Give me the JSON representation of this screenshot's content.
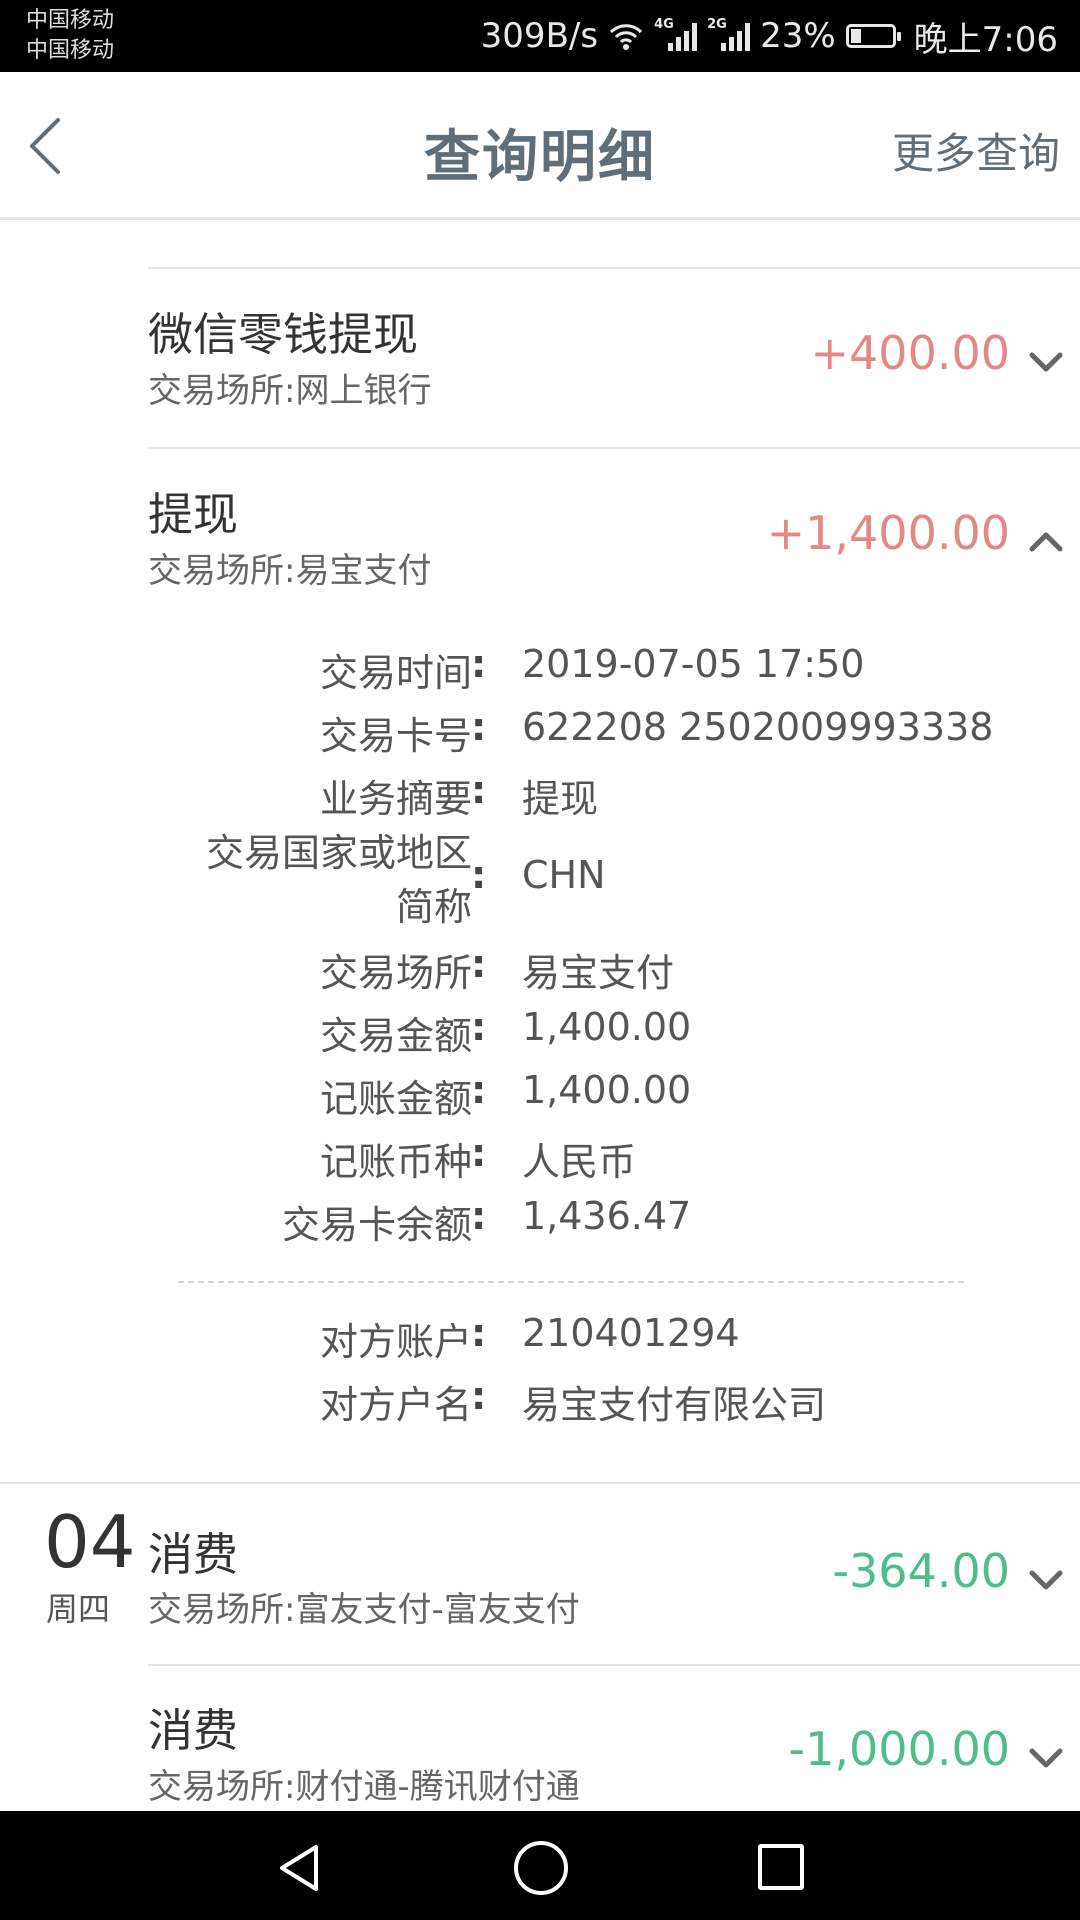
{
  "status_bar": {
    "carrier1": "中国移动",
    "carrier2": "中国移动",
    "net_speed": "309B/s",
    "signal1_tag": "4G",
    "signal2_tag": "2G",
    "battery": "23%",
    "time": "晚上7:06"
  },
  "header": {
    "title": "查询明细",
    "more": "更多查询"
  },
  "transactions": [
    {
      "title": "微信零钱提现",
      "venue": "交易场所:网上银行",
      "amount": "+400.00",
      "type": "income",
      "expanded": false
    },
    {
      "title": "提现",
      "venue": "交易场所:易宝支付",
      "amount": "+1,400.00",
      "type": "income",
      "expanded": true
    },
    {
      "date_day": "04",
      "date_week": "周四",
      "title": "消费",
      "venue": "交易场所:富友支付-富友支付",
      "amount": "-364.00",
      "type": "expense",
      "expanded": false
    },
    {
      "title": "消费",
      "venue": "交易场所:财付通-腾讯财付通",
      "amount": "-1,000.00",
      "type": "expense",
      "expanded": false
    }
  ],
  "details": {
    "time_label": "交易时间",
    "time_value": "2019-07-05 17:50",
    "card_label": "交易卡号",
    "card_value": "622208 2502009993338",
    "summary_label": "业务摘要",
    "summary_value": "提现",
    "country_label_line1": "交易国家或地区",
    "country_label_line2": "简称",
    "country_value": "CHN",
    "venue_label": "交易场所",
    "venue_value": "易宝支付",
    "amount_label": "交易金额",
    "amount_value": "1,400.00",
    "booked_label": "记账金额",
    "booked_value": "1,400.00",
    "currency_label": "记账币种",
    "currency_value": "人民币",
    "balance_label": "交易卡余额",
    "balance_value": "1,436.47",
    "counter_account_label": "对方账户",
    "counter_account_value": "210401294",
    "counter_name_label": "对方户名",
    "counter_name_value": "易宝支付有限公司",
    "colon": ":"
  },
  "colors": {
    "income": "#e48887",
    "expense": "#4fbd8a",
    "header_text": "#5f6e78"
  }
}
